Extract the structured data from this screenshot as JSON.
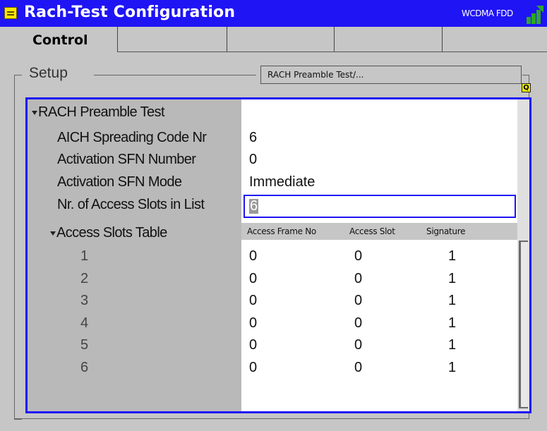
{
  "window": {
    "title": "Rach-Test Configuration",
    "standard": "WCDMA FDD",
    "accent": "#1f14f4"
  },
  "tabs": [
    {
      "label": "Control",
      "active": true
    },
    {
      "label": ""
    },
    {
      "label": ""
    },
    {
      "label": ""
    },
    {
      "label": ""
    }
  ],
  "setup": {
    "label": "Setup",
    "breadcrumb": "RACH Preamble Test/...",
    "indicator_icon": "q-icon",
    "indicator_text": "Q"
  },
  "tree": {
    "section_label": "RACH Preamble Test",
    "params": [
      {
        "label": "AICH Spreading Code Nr",
        "value": "6"
      },
      {
        "label": "Activation SFN Number",
        "value": "0"
      },
      {
        "label": "Activation SFN Mode",
        "value": "Immediate"
      },
      {
        "label": "Nr. of Access Slots in List",
        "value": "6"
      }
    ],
    "table_label": "Access Slots Table"
  },
  "table": {
    "headers": [
      "Access Frame No",
      "Access Slot",
      "Signature"
    ],
    "rows": [
      {
        "index": "1",
        "frame": "0",
        "slot": "0",
        "signature": "1"
      },
      {
        "index": "2",
        "frame": "0",
        "slot": "0",
        "signature": "1"
      },
      {
        "index": "3",
        "frame": "0",
        "slot": "0",
        "signature": "1"
      },
      {
        "index": "4",
        "frame": "0",
        "slot": "0",
        "signature": "1"
      },
      {
        "index": "5",
        "frame": "0",
        "slot": "0",
        "signature": "1"
      },
      {
        "index": "6",
        "frame": "0",
        "slot": "0",
        "signature": "1"
      }
    ]
  }
}
